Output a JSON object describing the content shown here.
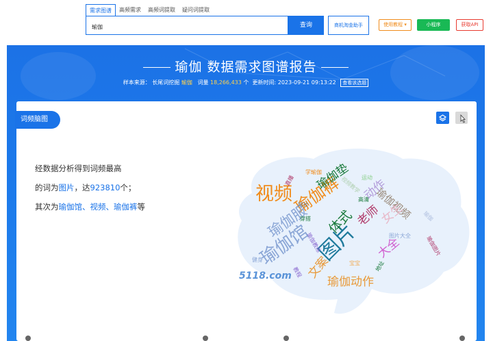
{
  "topbar": {
    "tabs": [
      "需求图谱",
      "高频需求",
      "高频词提取",
      "疑问词提取"
    ],
    "search_value": "瑜伽",
    "search_button": "查询",
    "assist_button": "商机淘金助手",
    "tutorial_button": "使用教程 ▾",
    "mini_program_button": "小程序",
    "api_button": "获取API"
  },
  "report": {
    "keyword": "瑜伽",
    "title_suffix": "数据需求图谱报告",
    "sample_source_label": "样本来源：",
    "sample_source_value": "长尾词挖掘",
    "sample_source_keyword": "瑜伽",
    "word_count_label": "词量",
    "word_count_value": "18,266,433",
    "word_count_unit": "个",
    "update_label": "更新时间:",
    "update_value": "2023-09-21 09:13:22",
    "view_selection": "查看该选题"
  },
  "card": {
    "tab_label": "词频脑图",
    "summary_line1": "经数据分析得到词频最高",
    "summary_line2_prefix": "的词为",
    "summary_top_word": "图片",
    "summary_line2_mid": "，达",
    "summary_top_count": "923810",
    "summary_line2_suffix": "个；",
    "summary_line3_prefix": "其次为",
    "summary_others": "瑜伽馆、视频、瑜伽裤",
    "summary_line3_suffix": "等"
  },
  "word_cloud": [
    {
      "text": "视频",
      "color": "#f08c1c",
      "size": 27
    },
    {
      "text": "瑜伽裤",
      "color": "#f08c1c",
      "size": 24
    },
    {
      "text": "图片",
      "color": "#1f7a9c",
      "size": 30
    },
    {
      "text": "瑜伽馆",
      "color": "#8aa6d6",
      "size": 26
    },
    {
      "text": "瑜伽服",
      "color": "#8aa6d6",
      "size": 21
    },
    {
      "text": "瑜伽垫",
      "color": "#1a7a3c",
      "size": 17
    },
    {
      "text": "瑜伽视频",
      "color": "#9a8a7a",
      "size": 15
    },
    {
      "text": "动作",
      "color": "#b39ddb",
      "size": 17
    },
    {
      "text": "女生",
      "color": "#e8b9c9",
      "size": 17
    },
    {
      "text": "老师",
      "color": "#b03a6a",
      "size": 17
    },
    {
      "text": "体式",
      "color": "#1a7a3c",
      "size": 19
    },
    {
      "text": "大全",
      "color": "#d060d0",
      "size": 17
    },
    {
      "text": "文案",
      "color": "#e89a3a",
      "size": 17
    },
    {
      "text": "瑜伽动作",
      "color": "#e89a3a",
      "size": 17
    },
    {
      "text": "高清",
      "color": "#1a7a3c",
      "size": 8
    },
    {
      "text": "照片",
      "color": "#6a7a8a",
      "size": 8
    },
    {
      "text": "穿搭",
      "color": "#1a7a3c",
      "size": 8
    },
    {
      "text": "直播",
      "color": "#b03a6a",
      "size": 8
    },
    {
      "text": "学瑜伽",
      "color": "#f08c1c",
      "size": 8
    },
    {
      "text": "运动",
      "color": "#8ad08a",
      "size": 8
    },
    {
      "text": "图片大全",
      "color": "#8aa6d6",
      "size": 8
    },
    {
      "text": "瑜伽图片",
      "color": "#b03a6a",
      "size": 8
    },
    {
      "text": "瑜伽教练",
      "color": "#8a6ad0",
      "size": 8
    },
    {
      "text": "地址",
      "color": "#1a7a3c",
      "size": 8
    },
    {
      "text": "宝宝",
      "color": "#f0b060",
      "size": 8
    },
    {
      "text": "健身",
      "color": "#8aa6d6",
      "size": 8
    },
    {
      "text": "教程",
      "color": "#8a6ad0",
      "size": 8
    },
    {
      "text": "瑜伽",
      "color": "#b0c0e0",
      "size": 8
    },
    {
      "text": "视频教学",
      "color": "#b0d0b0",
      "size": 8
    }
  ],
  "watermark": "5118.com"
}
